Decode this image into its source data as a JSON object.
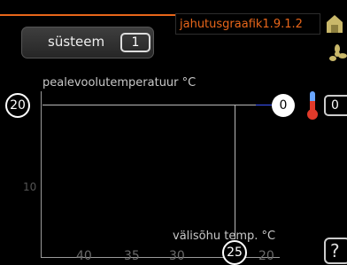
{
  "header": {
    "title": "jahutusgraafik1.9.1.2"
  },
  "system": {
    "label": "süsteem",
    "value": "1"
  },
  "chart_data": {
    "type": "line",
    "ylabel": "pealevoolutemperatuur °C",
    "xlabel": "välisõhu temp. °C",
    "yticks": [
      "20",
      "10"
    ],
    "xticks": [
      "40",
      "35",
      "30",
      "25",
      "20"
    ],
    "selected_point": {
      "x": 25,
      "y": 20
    },
    "offset_value": "0"
  },
  "right_panel": {
    "offset_value": "0"
  },
  "icons": {
    "top": "snowflake-house-icon",
    "middle": "fan-icon",
    "thermometer": "thermometer-icon",
    "help": "help-icon"
  },
  "help": {
    "label": "?"
  },
  "colors": {
    "accent": "#e8661a",
    "blue_line": "#3d56ff"
  }
}
